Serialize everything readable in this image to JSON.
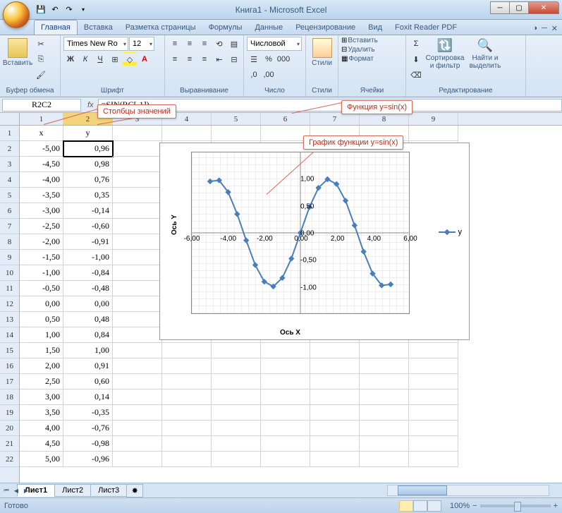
{
  "title": "Книга1 - Microsoft Excel",
  "tabs": {
    "home": "Главная",
    "insert": "Вставка",
    "layout": "Разметка страницы",
    "formulas": "Формулы",
    "data": "Данные",
    "review": "Рецензирование",
    "view": "Вид",
    "foxit": "Foxit Reader PDF"
  },
  "ribbon": {
    "clipboard": {
      "title": "Буфер обмена",
      "paste": "Вставить"
    },
    "font": {
      "title": "Шрифт",
      "name": "Times New Ro",
      "size": "12"
    },
    "align": {
      "title": "Выравнивание"
    },
    "number": {
      "title": "Число",
      "format": "Числовой"
    },
    "styles": {
      "title": "Стили",
      "btn": "Стили"
    },
    "cells": {
      "title": "Ячейки",
      "insert": "Вставить",
      "delete": "Удалить",
      "format": "Формат"
    },
    "edit": {
      "title": "Редактирование",
      "sort": "Сортировка и фильтр",
      "find": "Найти и выделить"
    }
  },
  "namebox": "R2C2",
  "formula": "=SIN(RC[-1])",
  "callouts": {
    "cols": "Столбцы значений",
    "func": "Функция y=sin(x)",
    "chart": "График функции y=sin(x)"
  },
  "col_headers": [
    "1",
    "2",
    "3",
    "4",
    "5",
    "6",
    "7",
    "8",
    "9"
  ],
  "row_headers": [
    "1",
    "2",
    "3",
    "4",
    "5",
    "6",
    "7",
    "8",
    "9",
    "10",
    "11",
    "12",
    "13",
    "14",
    "15",
    "16",
    "17",
    "18",
    "19",
    "20",
    "21",
    "22"
  ],
  "table": {
    "h1": "x",
    "h2": "y",
    "rows": [
      {
        "x": "-5,00",
        "y": "0,96"
      },
      {
        "x": "-4,50",
        "y": "0,98"
      },
      {
        "x": "-4,00",
        "y": "0,76"
      },
      {
        "x": "-3,50",
        "y": "0,35"
      },
      {
        "x": "-3,00",
        "y": "-0,14"
      },
      {
        "x": "-2,50",
        "y": "-0,60"
      },
      {
        "x": "-2,00",
        "y": "-0,91"
      },
      {
        "x": "-1,50",
        "y": "-1,00"
      },
      {
        "x": "-1,00",
        "y": "-0,84"
      },
      {
        "x": "-0,50",
        "y": "-0,48"
      },
      {
        "x": "0,00",
        "y": "0,00"
      },
      {
        "x": "0,50",
        "y": "0,48"
      },
      {
        "x": "1,00",
        "y": "0,84"
      },
      {
        "x": "1,50",
        "y": "1,00"
      },
      {
        "x": "2,00",
        "y": "0,91"
      },
      {
        "x": "2,50",
        "y": "0,60"
      },
      {
        "x": "3,00",
        "y": "0,14"
      },
      {
        "x": "3,50",
        "y": "-0,35"
      },
      {
        "x": "4,00",
        "y": "-0,76"
      },
      {
        "x": "4,50",
        "y": "-0,98"
      },
      {
        "x": "5,00",
        "y": "-0,96"
      }
    ]
  },
  "chart_data": {
    "type": "line",
    "title": "",
    "xlabel": "Ось X",
    "ylabel": "Ось Y",
    "xlim": [
      -6,
      6
    ],
    "ylim": [
      -1.5,
      1.5
    ],
    "x_ticks": [
      "-6,00",
      "-4,00",
      "-2,00",
      "0,00",
      "2,00",
      "4,00",
      "6,00"
    ],
    "y_ticks": [
      "1,00",
      "0,50",
      "0,00",
      "-0,50",
      "-1,00"
    ],
    "series": [
      {
        "name": "y",
        "x": [
          -5,
          -4.5,
          -4,
          -3.5,
          -3,
          -2.5,
          -2,
          -1.5,
          -1,
          -0.5,
          0,
          0.5,
          1,
          1.5,
          2,
          2.5,
          3,
          3.5,
          4,
          4.5,
          5
        ],
        "values": [
          0.96,
          0.98,
          0.76,
          0.35,
          -0.14,
          -0.6,
          -0.91,
          -1.0,
          -0.84,
          -0.48,
          0.0,
          0.48,
          0.84,
          1.0,
          0.91,
          0.6,
          0.14,
          -0.35,
          -0.76,
          -0.98,
          -0.96
        ]
      }
    ]
  },
  "sheets": {
    "s1": "Лист1",
    "s2": "Лист2",
    "s3": "Лист3"
  },
  "status": {
    "ready": "Готово",
    "zoom": "100%"
  },
  "legend": "y"
}
